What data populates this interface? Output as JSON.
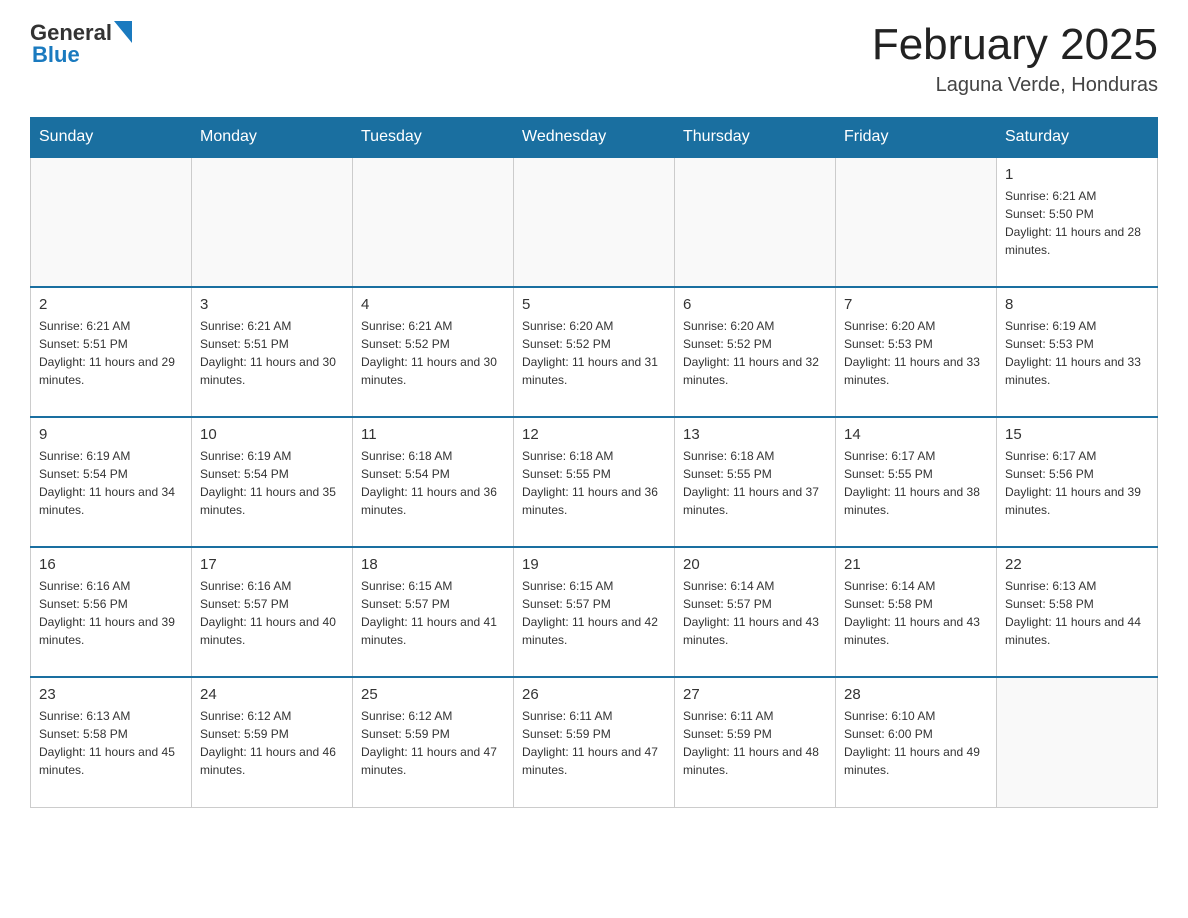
{
  "logo": {
    "general": "General",
    "blue": "Blue",
    "tagline": "GeneralBlue"
  },
  "header": {
    "title": "February 2025",
    "subtitle": "Laguna Verde, Honduras"
  },
  "weekdays": [
    "Sunday",
    "Monday",
    "Tuesday",
    "Wednesday",
    "Thursday",
    "Friday",
    "Saturday"
  ],
  "weeks": [
    [
      {
        "day": "",
        "info": ""
      },
      {
        "day": "",
        "info": ""
      },
      {
        "day": "",
        "info": ""
      },
      {
        "day": "",
        "info": ""
      },
      {
        "day": "",
        "info": ""
      },
      {
        "day": "",
        "info": ""
      },
      {
        "day": "1",
        "info": "Sunrise: 6:21 AM\nSunset: 5:50 PM\nDaylight: 11 hours and 28 minutes."
      }
    ],
    [
      {
        "day": "2",
        "info": "Sunrise: 6:21 AM\nSunset: 5:51 PM\nDaylight: 11 hours and 29 minutes."
      },
      {
        "day": "3",
        "info": "Sunrise: 6:21 AM\nSunset: 5:51 PM\nDaylight: 11 hours and 30 minutes."
      },
      {
        "day": "4",
        "info": "Sunrise: 6:21 AM\nSunset: 5:52 PM\nDaylight: 11 hours and 30 minutes."
      },
      {
        "day": "5",
        "info": "Sunrise: 6:20 AM\nSunset: 5:52 PM\nDaylight: 11 hours and 31 minutes."
      },
      {
        "day": "6",
        "info": "Sunrise: 6:20 AM\nSunset: 5:52 PM\nDaylight: 11 hours and 32 minutes."
      },
      {
        "day": "7",
        "info": "Sunrise: 6:20 AM\nSunset: 5:53 PM\nDaylight: 11 hours and 33 minutes."
      },
      {
        "day": "8",
        "info": "Sunrise: 6:19 AM\nSunset: 5:53 PM\nDaylight: 11 hours and 33 minutes."
      }
    ],
    [
      {
        "day": "9",
        "info": "Sunrise: 6:19 AM\nSunset: 5:54 PM\nDaylight: 11 hours and 34 minutes."
      },
      {
        "day": "10",
        "info": "Sunrise: 6:19 AM\nSunset: 5:54 PM\nDaylight: 11 hours and 35 minutes."
      },
      {
        "day": "11",
        "info": "Sunrise: 6:18 AM\nSunset: 5:54 PM\nDaylight: 11 hours and 36 minutes."
      },
      {
        "day": "12",
        "info": "Sunrise: 6:18 AM\nSunset: 5:55 PM\nDaylight: 11 hours and 36 minutes."
      },
      {
        "day": "13",
        "info": "Sunrise: 6:18 AM\nSunset: 5:55 PM\nDaylight: 11 hours and 37 minutes."
      },
      {
        "day": "14",
        "info": "Sunrise: 6:17 AM\nSunset: 5:55 PM\nDaylight: 11 hours and 38 minutes."
      },
      {
        "day": "15",
        "info": "Sunrise: 6:17 AM\nSunset: 5:56 PM\nDaylight: 11 hours and 39 minutes."
      }
    ],
    [
      {
        "day": "16",
        "info": "Sunrise: 6:16 AM\nSunset: 5:56 PM\nDaylight: 11 hours and 39 minutes."
      },
      {
        "day": "17",
        "info": "Sunrise: 6:16 AM\nSunset: 5:57 PM\nDaylight: 11 hours and 40 minutes."
      },
      {
        "day": "18",
        "info": "Sunrise: 6:15 AM\nSunset: 5:57 PM\nDaylight: 11 hours and 41 minutes."
      },
      {
        "day": "19",
        "info": "Sunrise: 6:15 AM\nSunset: 5:57 PM\nDaylight: 11 hours and 42 minutes."
      },
      {
        "day": "20",
        "info": "Sunrise: 6:14 AM\nSunset: 5:57 PM\nDaylight: 11 hours and 43 minutes."
      },
      {
        "day": "21",
        "info": "Sunrise: 6:14 AM\nSunset: 5:58 PM\nDaylight: 11 hours and 43 minutes."
      },
      {
        "day": "22",
        "info": "Sunrise: 6:13 AM\nSunset: 5:58 PM\nDaylight: 11 hours and 44 minutes."
      }
    ],
    [
      {
        "day": "23",
        "info": "Sunrise: 6:13 AM\nSunset: 5:58 PM\nDaylight: 11 hours and 45 minutes."
      },
      {
        "day": "24",
        "info": "Sunrise: 6:12 AM\nSunset: 5:59 PM\nDaylight: 11 hours and 46 minutes."
      },
      {
        "day": "25",
        "info": "Sunrise: 6:12 AM\nSunset: 5:59 PM\nDaylight: 11 hours and 47 minutes."
      },
      {
        "day": "26",
        "info": "Sunrise: 6:11 AM\nSunset: 5:59 PM\nDaylight: 11 hours and 47 minutes."
      },
      {
        "day": "27",
        "info": "Sunrise: 6:11 AM\nSunset: 5:59 PM\nDaylight: 11 hours and 48 minutes."
      },
      {
        "day": "28",
        "info": "Sunrise: 6:10 AM\nSunset: 6:00 PM\nDaylight: 11 hours and 49 minutes."
      },
      {
        "day": "",
        "info": ""
      }
    ]
  ]
}
